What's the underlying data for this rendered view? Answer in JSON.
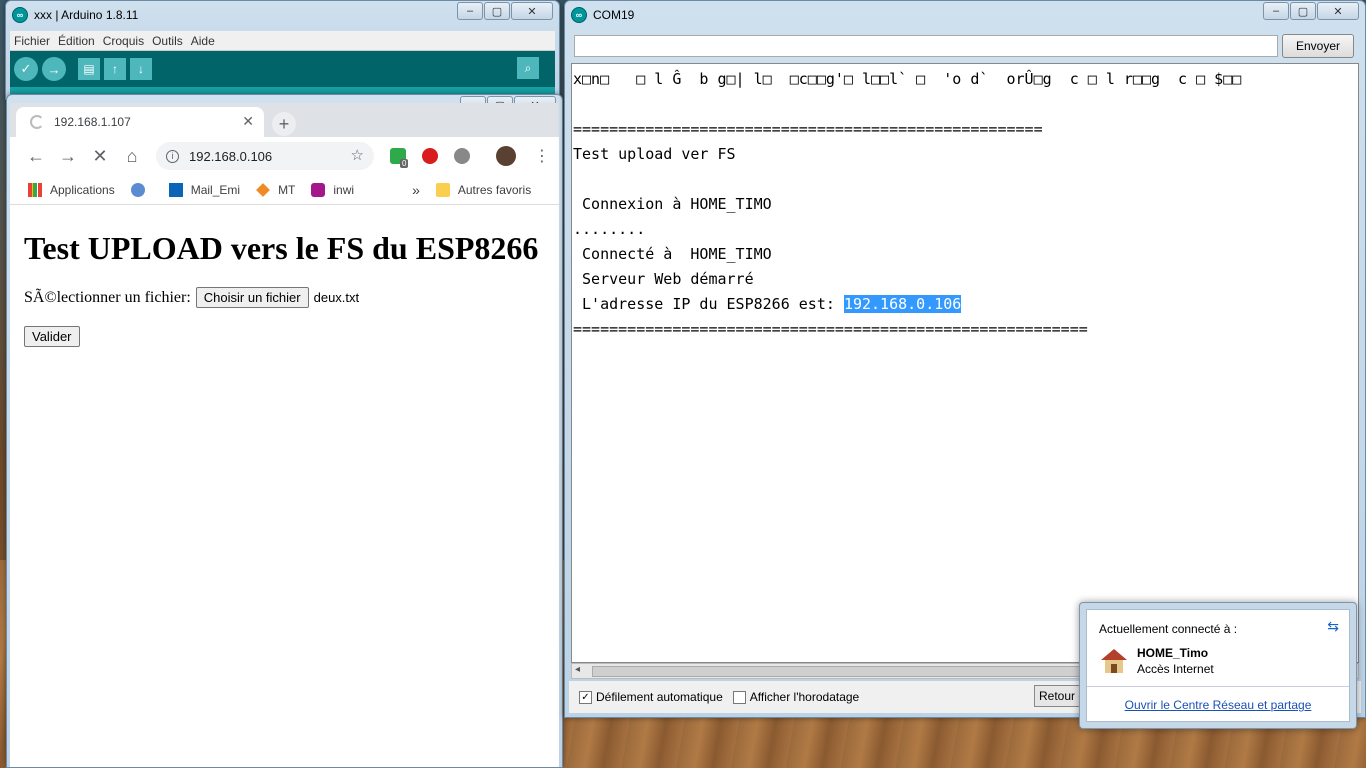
{
  "arduino": {
    "title": "xxx | Arduino 1.8.11",
    "menu": [
      "Fichier",
      "Édition",
      "Croquis",
      "Outils",
      "Aide"
    ]
  },
  "chrome": {
    "tab_title": "192.168.1.107",
    "url": "192.168.0.106",
    "extension_badge": "0",
    "bookmarks": [
      "Applications",
      "Mail_Emi",
      "MT",
      "inwi"
    ],
    "more_bookmarks": "»",
    "other_bookmarks": "Autres favoris",
    "page": {
      "heading": "Test UPLOAD vers le FS du ESP8266",
      "file_label": "SÃ©lectionner un fichier:",
      "file_button": "Choisir un fichier",
      "file_name": "deux.txt",
      "submit": "Valider"
    }
  },
  "serial": {
    "title": "COM19",
    "send_label": "Envoyer",
    "output": {
      "garbage": "x□n□   □ l Ĝ  b g□| l□  □c□□g'□ l□□l` □  'o d`  orÛ□g  c □ l r□□g  c □ $□□",
      "sep1": "====================================================",
      "title_line": "Test upload ver FS",
      "connecting": " Connexion à HOME_TIMO",
      "dots": "........",
      "connected": " Connecté à  HOME_TIMO",
      "server": " Serveur Web démarré",
      "ip_label": " L'adresse IP du ESP8266 est: ",
      "ip_value": "192.168.0.106",
      "sep2": "========================================================="
    },
    "autoscroll": "Défilement automatique",
    "timestamp": "Afficher l'horodatage",
    "line_ending": "Retour c"
  },
  "network_popup": {
    "header": "Actuellement connecté à :",
    "network_name": "HOME_Timo",
    "status": "Accès Internet",
    "link": "Ouvrir le Centre Réseau et partage"
  }
}
